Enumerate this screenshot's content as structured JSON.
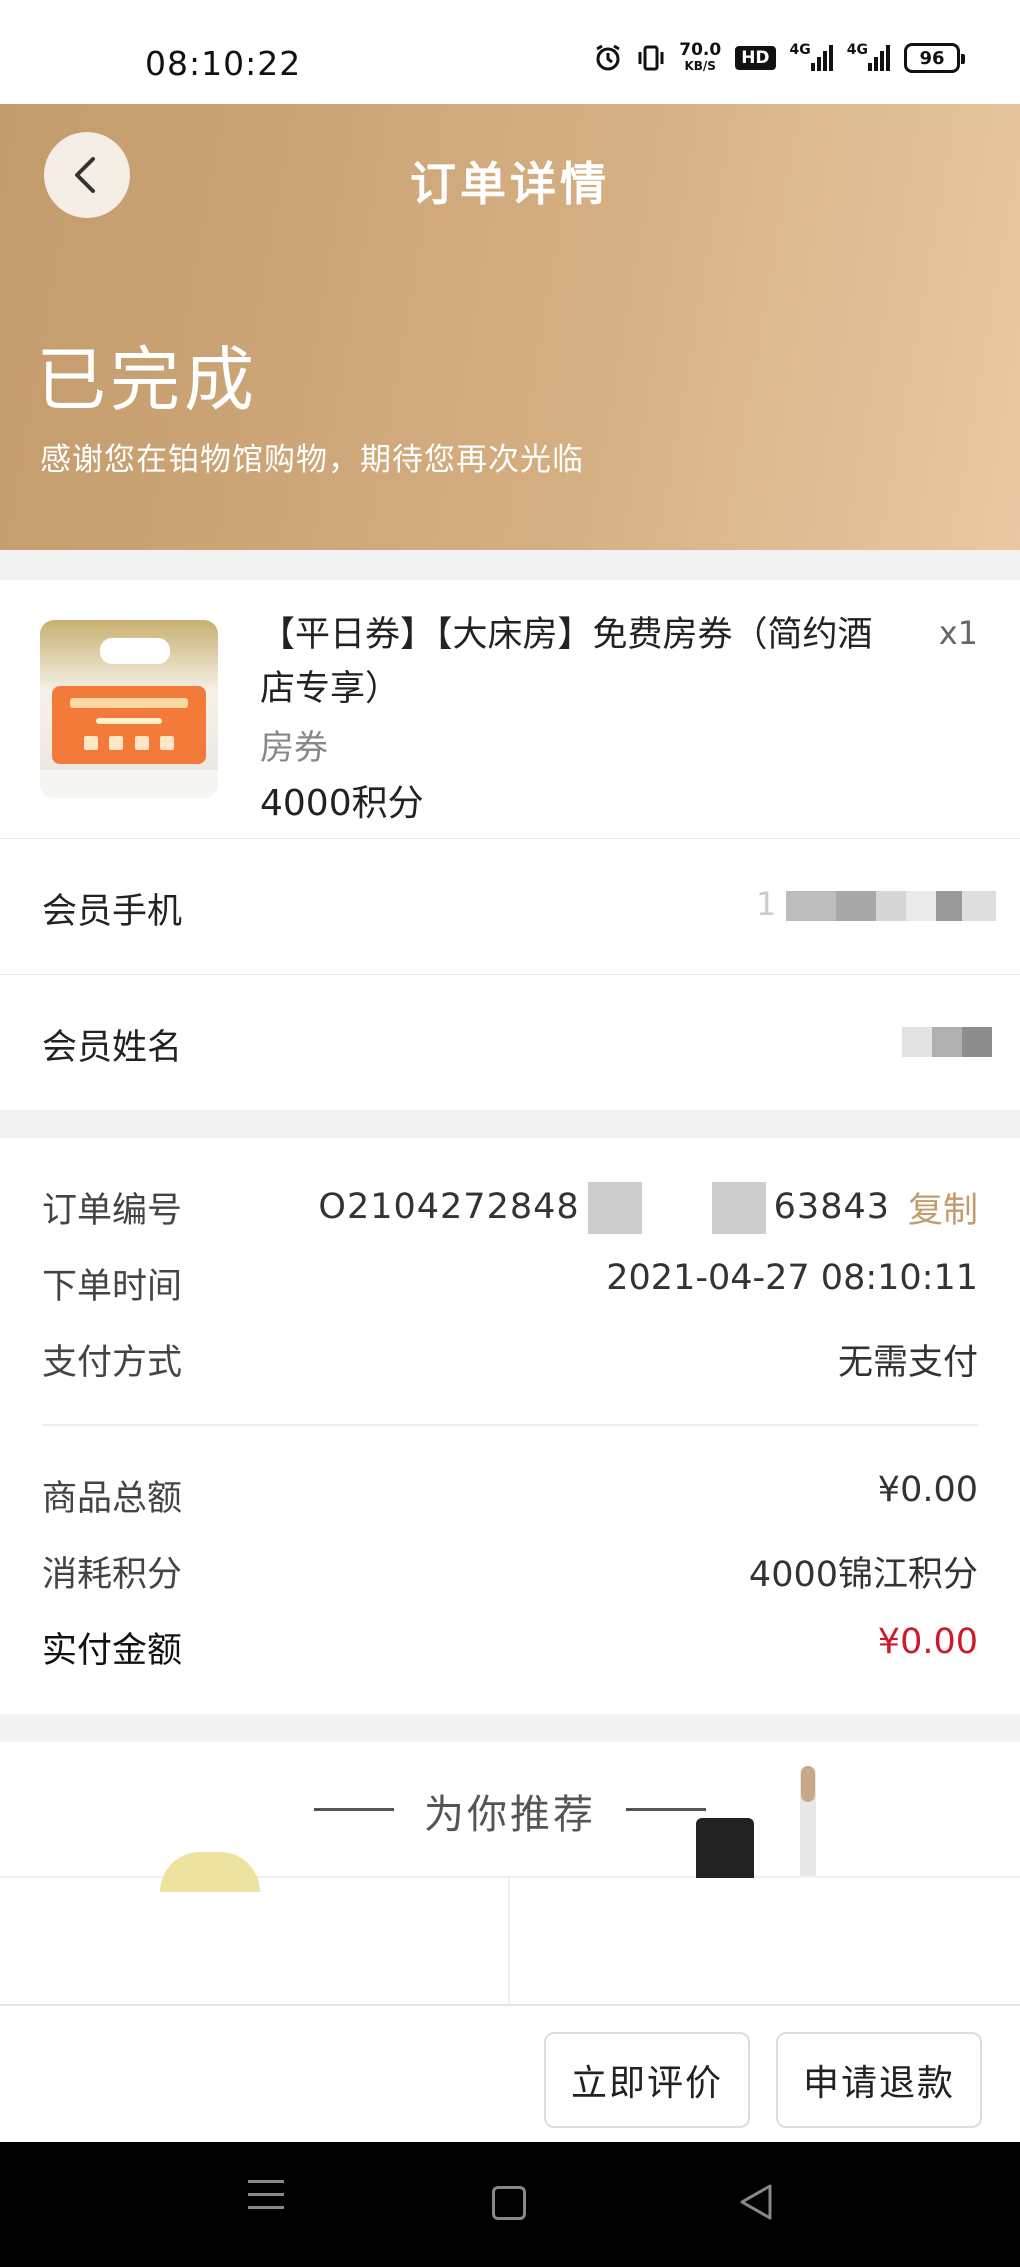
{
  "status_bar": {
    "time": "08:10:22",
    "speed_value": "70.0",
    "speed_unit": "KB/S",
    "hd_label": "HD",
    "network_1": "4G",
    "network_2": "4G",
    "battery": "96",
    "icons": [
      "alarm-icon",
      "vibrate-icon",
      "signal-icon",
      "battery-icon"
    ]
  },
  "header": {
    "title": "订单详情",
    "back_icon": "chevron-left-icon"
  },
  "order_status": {
    "title": "已完成",
    "subtitle": "感谢您在铂物馆购物，期待您再次光临"
  },
  "product": {
    "name": "【平日券】【大床房】免费房券（简约酒店专享）",
    "quantity": "x1",
    "category": "房券",
    "price": "4000积分"
  },
  "member": {
    "phone_label": "会员手机",
    "phone_value_visible": "1",
    "name_label": "会员姓名"
  },
  "order": {
    "number_label": "订单编号",
    "number_prefix": "O2104272848",
    "number_suffix": "63843",
    "copy_label": "复制",
    "time_label": "下单时间",
    "time_value": "2021-04-27 08:10:11",
    "payment_label": "支付方式",
    "payment_value": "无需支付",
    "total_label": "商品总额",
    "total_value": "¥0.00",
    "points_label": "消耗积分",
    "points_value": "4000锦江积分",
    "paid_label": "实付金额",
    "paid_value": "¥0.00"
  },
  "recommend": {
    "title": "为你推荐"
  },
  "actions": {
    "review_label": "立即评价",
    "refund_label": "申请退款"
  },
  "colors": {
    "accent": "#c39b6c",
    "price_red": "#d0182c",
    "banner_start": "#c39b6c",
    "banner_end": "#e8c9a2"
  }
}
